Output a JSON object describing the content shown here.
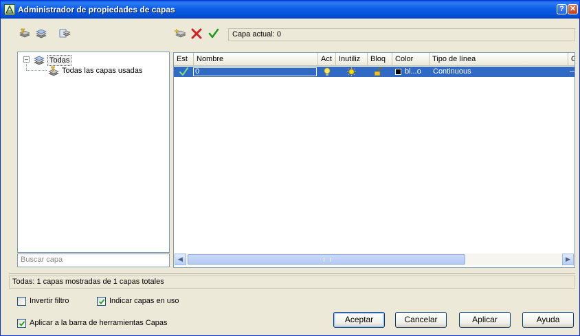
{
  "window": {
    "title": "Administrador de propiedades de capas",
    "help_button": "?",
    "close_button": "✕"
  },
  "toolbar": {
    "left_icons": [
      "new-layer-filter-icon",
      "new-group-filter-icon",
      "layer-states-manager-icon"
    ],
    "right_icons": [
      "new-layer-icon",
      "delete-layer-icon",
      "set-current-icon"
    ],
    "current_layer": "Capa actual: 0"
  },
  "tree": {
    "root_label": "Todas",
    "child_label": "Todas las capas usadas",
    "expander": "⊟"
  },
  "search": {
    "placeholder": "Buscar capa"
  },
  "grid": {
    "columns": [
      "Est",
      "Nombre",
      "Act",
      "Inutiliz",
      "Bloq",
      "Color",
      "Tipo de línea",
      "G"
    ],
    "rows": [
      {
        "status_icon": "current-check-icon",
        "name": "0",
        "on_icon": "lightbulb-on-icon",
        "freeze_icon": "sun-thawed-icon",
        "lock_icon": "unlocked-padlock-icon",
        "color_swatch": "#000000",
        "color": "bl...o",
        "linetype": "Continuous",
        "lineweight": "—"
      }
    ]
  },
  "scrollbar": {
    "left_arrow": "◀",
    "right_arrow": "▶"
  },
  "status": {
    "text": "Todas: 1 capas mostradas de 1 capas totales"
  },
  "options": {
    "invert_filter": {
      "label": "Invertir filtro",
      "checked": false
    },
    "indicate_in_use": {
      "label": "Indicar capas en uso",
      "checked": true
    },
    "apply_to_toolbar": {
      "label": "Aplicar a la barra de herramientas Capas",
      "checked": true
    }
  },
  "buttons": {
    "ok": "Aceptar",
    "cancel": "Cancelar",
    "apply": "Aplicar",
    "help": "Ayuda"
  },
  "colors": {
    "selection": "#316ac5",
    "title_bar": "#0452d7",
    "check_green": "#1a9b1a",
    "delete_red": "#d42020"
  }
}
